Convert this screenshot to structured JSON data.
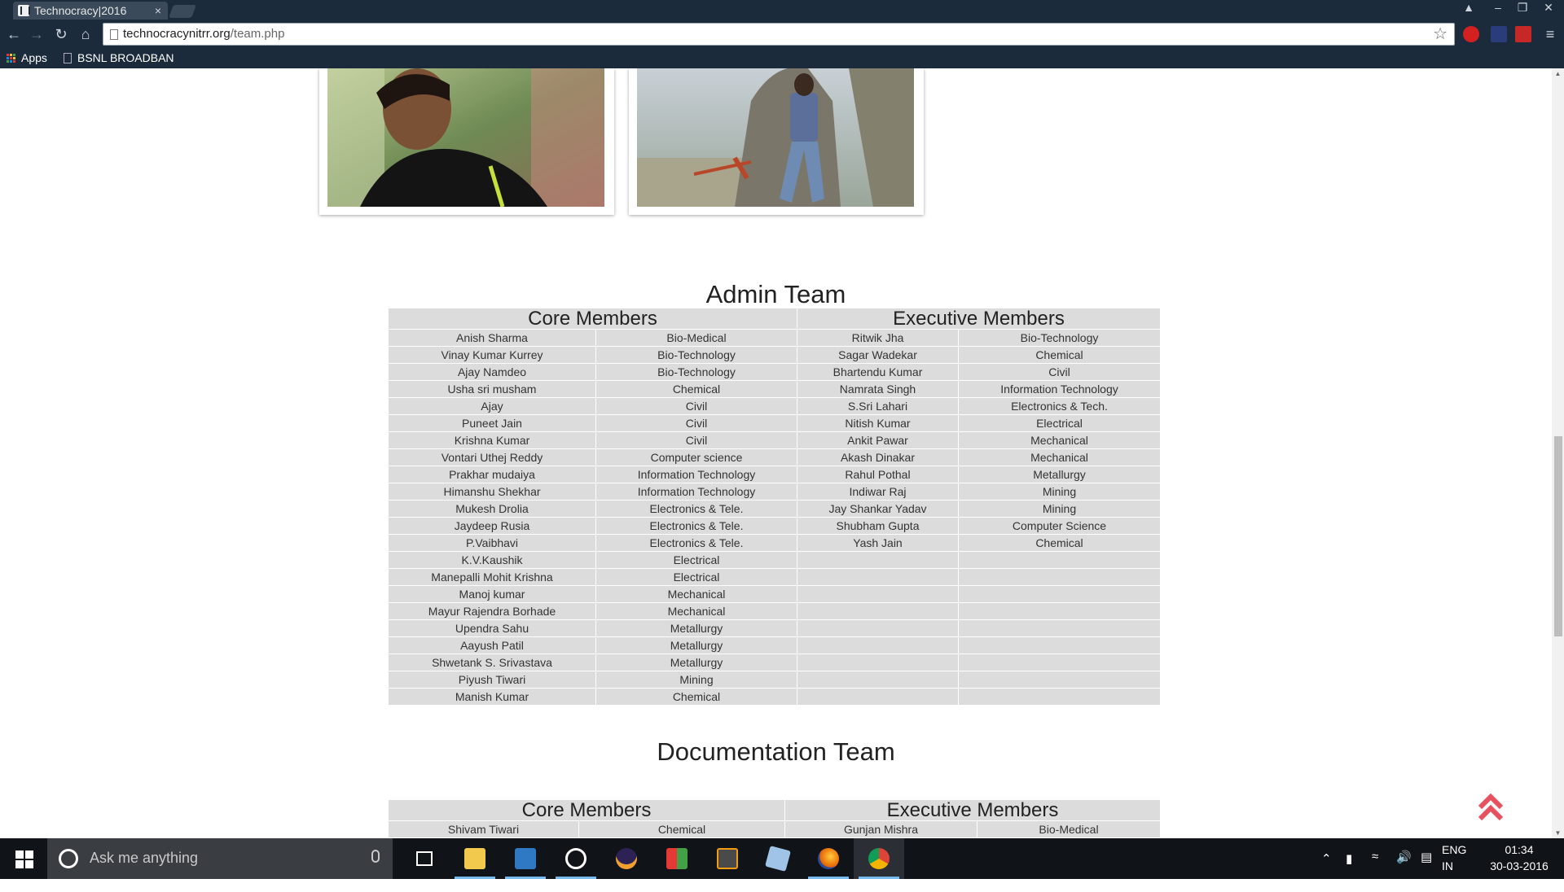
{
  "browser": {
    "tab_title": "Technocracy|2016",
    "tab_close": "×",
    "url_host": "technocracynitrr.org",
    "url_path": "/team.php",
    "bookmarks": {
      "apps": "Apps",
      "bsnl": "BSNL BROADBAN"
    }
  },
  "admin": {
    "title": "Admin Team",
    "core_header": "Core Members",
    "exec_header": "Executive Members",
    "core": [
      [
        "Anish Sharma",
        "Bio-Medical"
      ],
      [
        "Vinay Kumar Kurrey",
        "Bio-Technology"
      ],
      [
        "Ajay Namdeo",
        "Bio-Technology"
      ],
      [
        "Usha sri musham",
        "Chemical"
      ],
      [
        "Ajay",
        "Civil"
      ],
      [
        "Puneet Jain",
        "Civil"
      ],
      [
        "Krishna Kumar",
        "Civil"
      ],
      [
        "Vontari Uthej Reddy",
        "Computer science"
      ],
      [
        "Prakhar mudaiya",
        "Information Technology"
      ],
      [
        "Himanshu Shekhar",
        "Information Technology"
      ],
      [
        "Mukesh Drolia",
        "Electronics & Tele."
      ],
      [
        "Jaydeep Rusia",
        "Electronics & Tele."
      ],
      [
        "P.Vaibhavi",
        "Electronics & Tele."
      ],
      [
        "K.V.Kaushik",
        "Electrical"
      ],
      [
        "Manepalli Mohit Krishna",
        "Electrical"
      ],
      [
        "Manoj kumar",
        "Mechanical"
      ],
      [
        "Mayur Rajendra Borhade",
        "Mechanical"
      ],
      [
        "Upendra Sahu",
        "Metallurgy"
      ],
      [
        "Aayush Patil",
        "Metallurgy"
      ],
      [
        "Shwetank S. Srivastava",
        "Metallurgy"
      ],
      [
        "Piyush Tiwari",
        "Mining"
      ],
      [
        "Manish Kumar",
        "Chemical"
      ]
    ],
    "exec": [
      [
        "Ritwik Jha",
        "Bio-Technology"
      ],
      [
        "Sagar Wadekar",
        "Chemical"
      ],
      [
        "Bhartendu Kumar",
        "Civil"
      ],
      [
        "Namrata Singh",
        "Information Technology"
      ],
      [
        "S.Sri Lahari",
        "Electronics & Tech."
      ],
      [
        "Nitish Kumar",
        "Electrical"
      ],
      [
        "Ankit Pawar",
        "Mechanical"
      ],
      [
        "Akash Dinakar",
        "Mechanical"
      ],
      [
        "Rahul Pothal",
        "Metallurgy"
      ],
      [
        "Indiwar Raj",
        "Mining"
      ],
      [
        "Jay Shankar Yadav",
        "Mining"
      ],
      [
        "Shubham Gupta",
        "Computer Science"
      ],
      [
        "Yash Jain",
        "Chemical"
      ]
    ]
  },
  "documentation": {
    "title": "Documentation Team",
    "core_header": "Core Members",
    "exec_header": "Executive Members",
    "core": [
      [
        "Shivam Tiwari",
        "Chemical"
      ]
    ],
    "exec": [
      [
        "Gunjan Mishra",
        "Bio-Medical"
      ]
    ]
  },
  "taskbar": {
    "search_placeholder": "Ask me anything",
    "lang_1": "ENG",
    "lang_2": "IN",
    "time": "01:34",
    "date": "30-03-2016"
  },
  "colors": {
    "chrome_frame": "#1b2b3c",
    "table_bg": "#dcdcdc",
    "scroll_top_arrow": "#e8515f",
    "taskbar": "#101418"
  }
}
